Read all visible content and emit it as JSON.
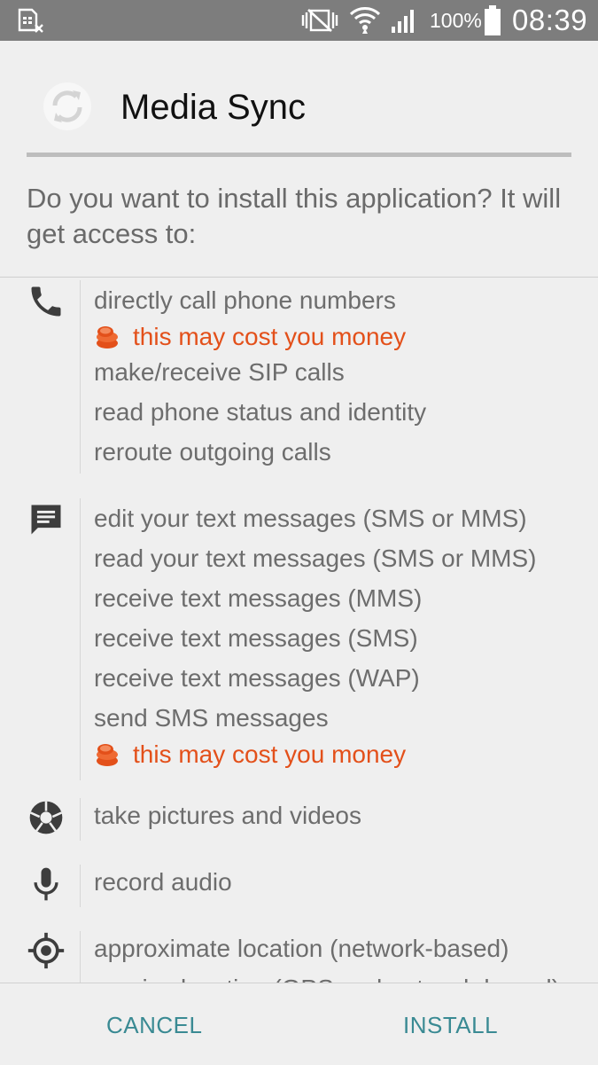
{
  "status_bar": {
    "icons": [
      "sim-notification-icon",
      "vibrate-mute-icon",
      "wifi-icon",
      "signal-icon",
      "battery-icon"
    ],
    "battery_percent": "100%",
    "time": "08:39"
  },
  "app": {
    "icon": "sync-icon",
    "name": "Media Sync"
  },
  "prompt": "Do you want to install this application? It will get access to:",
  "permission_groups": [
    {
      "icon": "phone-icon",
      "items": [
        "directly call phone numbers",
        "this may cost you money",
        "make/receive SIP calls",
        "read phone status and identity",
        "reroute outgoing calls"
      ]
    },
    {
      "icon": "message-icon",
      "items": [
        "edit your text messages (SMS or MMS)",
        "read your text messages (SMS or MMS)",
        "receive text messages (MMS)",
        "receive text messages (SMS)",
        "receive text messages (WAP)",
        "send SMS messages",
        "this may cost you money"
      ]
    },
    {
      "icon": "camera-aperture-icon",
      "items": [
        "take pictures and videos"
      ]
    },
    {
      "icon": "microphone-icon",
      "items": [
        "record audio"
      ]
    },
    {
      "icon": "location-icon",
      "items": [
        "approximate location (network-based)",
        "precise location (GPS and network-based)"
      ]
    }
  ],
  "cost_warning_icon": "coins-icon",
  "buttons": {
    "cancel": "CANCEL",
    "install": "INSTALL"
  },
  "colors": {
    "status_bar": "#7d7d7d",
    "background": "#efefef",
    "warning": "#e3501a",
    "button_text": "#3a8a93"
  }
}
